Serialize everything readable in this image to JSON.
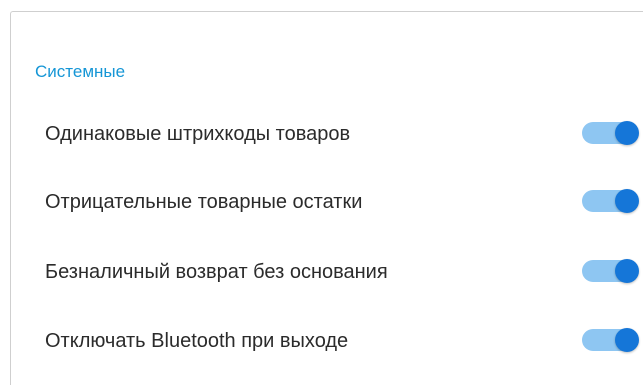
{
  "section": {
    "title": "Системные"
  },
  "settings": [
    {
      "label": "Одинаковые штрихкоды товаров",
      "enabled": true
    },
    {
      "label": "Отрицательные товарные остатки",
      "enabled": true
    },
    {
      "label": "Безналичный возврат без основания",
      "enabled": true
    },
    {
      "label": "Отключать Bluetooth при выходе",
      "enabled": true
    }
  ],
  "colors": {
    "accent": "#1596d6",
    "toggle_track_on": "#8ec6f2",
    "toggle_thumb_on": "#1576d8",
    "text": "#2b2b2b"
  }
}
